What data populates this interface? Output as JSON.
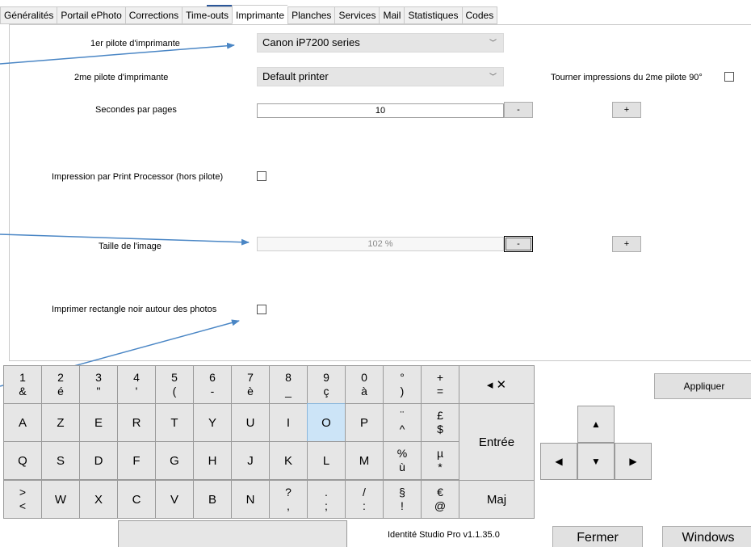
{
  "tabs": [
    {
      "label": "Généralités"
    },
    {
      "label": "Portail ePhoto"
    },
    {
      "label": "Corrections"
    },
    {
      "label": "Time-outs"
    },
    {
      "label": "Imprimante"
    },
    {
      "label": "Planches"
    },
    {
      "label": "Services"
    },
    {
      "label": "Mail"
    },
    {
      "label": "Statistiques"
    },
    {
      "label": "Codes"
    }
  ],
  "active_tab": "Imprimante",
  "printer": {
    "driver1_label": "1er pilote d'imprimante",
    "driver1_value": "Canon iP7200 series",
    "driver2_label": "2me pilote d'imprimante",
    "driver2_value": "Default printer",
    "rotate_label": "Tourner impressions du 2me pilote 90°",
    "rotate_checked": false,
    "seconds_label": "Secondes par pages",
    "seconds_value": "10",
    "print_processor_label": "Impression par Print Processor (hors pilote)",
    "print_processor_checked": false,
    "image_size_label": "Taille de l'image",
    "image_size_value": "102 %",
    "black_rect_label": "Imprimer rectangle noir autour des photos",
    "black_rect_checked": false,
    "minus_label": "-",
    "plus_label": "+"
  },
  "keyboard": {
    "row1": [
      {
        "top": "1",
        "bot": "&"
      },
      {
        "top": "2",
        "bot": "é"
      },
      {
        "top": "3",
        "bot": "\""
      },
      {
        "top": "4",
        "bot": "'"
      },
      {
        "top": "5",
        "bot": "("
      },
      {
        "top": "6",
        "bot": "-"
      },
      {
        "top": "7",
        "bot": "è"
      },
      {
        "top": "8",
        "bot": "_"
      },
      {
        "top": "9",
        "bot": "ç"
      },
      {
        "top": "0",
        "bot": "à"
      },
      {
        "top": "°",
        "bot": ")"
      },
      {
        "top": "+",
        "bot": "="
      }
    ],
    "backspace_label": "◂ ✕",
    "row2": [
      {
        "label": "A"
      },
      {
        "label": "Z"
      },
      {
        "label": "E"
      },
      {
        "label": "R"
      },
      {
        "label": "T"
      },
      {
        "label": "Y"
      },
      {
        "label": "U"
      },
      {
        "label": "I"
      },
      {
        "label": "O"
      },
      {
        "label": "P"
      }
    ],
    "row2_extra": [
      {
        "top": "¨",
        "bot": "^"
      },
      {
        "top": "£",
        "bot": "$"
      }
    ],
    "row3": [
      {
        "label": "Q"
      },
      {
        "label": "S"
      },
      {
        "label": "D"
      },
      {
        "label": "F"
      },
      {
        "label": "G"
      },
      {
        "label": "H"
      },
      {
        "label": "J"
      },
      {
        "label": "K"
      },
      {
        "label": "L"
      },
      {
        "label": "M"
      }
    ],
    "row3_extra": [
      {
        "top": "%",
        "bot": "ù"
      },
      {
        "top": "µ",
        "bot": "*"
      }
    ],
    "enter_label": "Entrée",
    "row4_first": {
      "top": ">",
      "bot": "<"
    },
    "row4": [
      {
        "label": "W"
      },
      {
        "label": "X"
      },
      {
        "label": "C"
      },
      {
        "label": "V"
      },
      {
        "label": "B"
      },
      {
        "label": "N"
      }
    ],
    "row4_extra": [
      {
        "top": "?",
        "bot": ","
      },
      {
        "top": ".",
        "bot": ";"
      },
      {
        "top": "/",
        "bot": ":"
      },
      {
        "top": "§",
        "bot": "!"
      },
      {
        "top": "€",
        "bot": "@"
      }
    ],
    "shift_label": "Maj",
    "active_key": "O"
  },
  "arrows": {
    "up": "▲",
    "down": "▼",
    "left": "◀",
    "right": "▶"
  },
  "buttons": {
    "apply": "Appliquer",
    "close": "Fermer",
    "windows": "Windows"
  },
  "version": "Identité Studio Pro  v1.1.35.0"
}
